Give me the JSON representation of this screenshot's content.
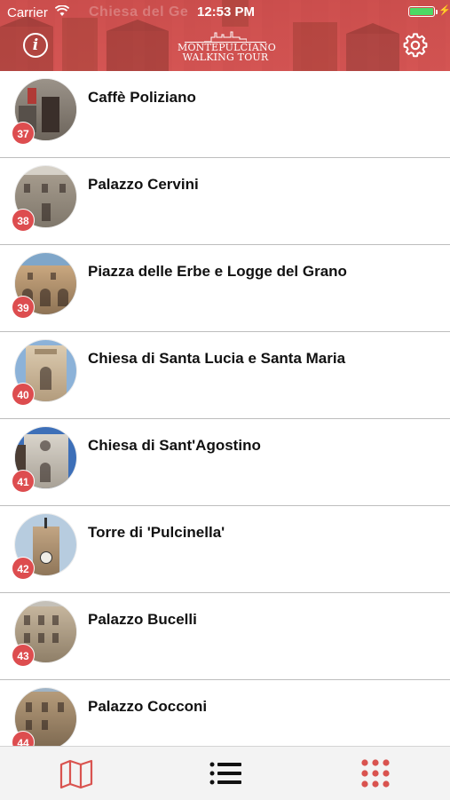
{
  "status_bar": {
    "carrier": "Carrier",
    "time": "12:53 PM",
    "ghost_title": "Chiesa del Ge"
  },
  "header": {
    "logo_line1": "MONTEPULCIANO",
    "logo_line2": "WALKING TOUR",
    "info_icon": "info-icon",
    "settings_icon": "gear-icon",
    "accent_color": "#d9534f"
  },
  "places": [
    {
      "number": "37",
      "name": "Caffè Poliziano"
    },
    {
      "number": "38",
      "name": "Palazzo Cervini"
    },
    {
      "number": "39",
      "name": "Piazza delle Erbe e Logge del Grano"
    },
    {
      "number": "40",
      "name": "Chiesa di Santa Lucia e Santa Maria"
    },
    {
      "number": "41",
      "name": "Chiesa di Sant'Agostino"
    },
    {
      "number": "42",
      "name": "Torre di 'Pulcinella'"
    },
    {
      "number": "43",
      "name": "Palazzo Bucelli"
    },
    {
      "number": "44",
      "name": "Palazzo Cocconi"
    }
  ],
  "tab_bar": {
    "tabs": [
      {
        "icon": "map-icon",
        "active": false
      },
      {
        "icon": "list-icon",
        "active": true
      },
      {
        "icon": "grid-icon",
        "active": false
      }
    ],
    "active_color": "#111111",
    "inactive_color": "#d9534f"
  }
}
